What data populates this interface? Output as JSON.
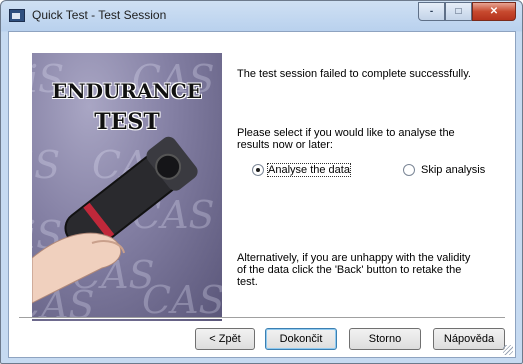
{
  "window": {
    "title": "Quick Test - Test Session",
    "controls": {
      "minimize": "-",
      "maximize": "□",
      "close": "✕"
    }
  },
  "banner": {
    "line1": "ENDURANCE",
    "line2": "TEST",
    "watermark": [
      "iS",
      "CAS",
      "iS",
      "CAS",
      "CAS",
      "iS",
      "CAS",
      "CAS",
      "CAS"
    ]
  },
  "content": {
    "status_message": "The test session failed to complete successfully.",
    "prompt_line1": "Please select if you would like to analyse the",
    "prompt_line2": "results now or later:",
    "options": [
      {
        "label": "Analyse the data",
        "selected": true
      },
      {
        "label": "Skip analysis",
        "selected": false
      }
    ],
    "hint_line1": "Alternatively, if you are unhappy with the validity",
    "hint_line2": "of the data click the 'Back' button to retake the",
    "hint_line3": "test."
  },
  "buttons": {
    "back": "< Zpět",
    "finish": "Dokončit",
    "cancel": "Storno",
    "help": "Nápověda"
  }
}
